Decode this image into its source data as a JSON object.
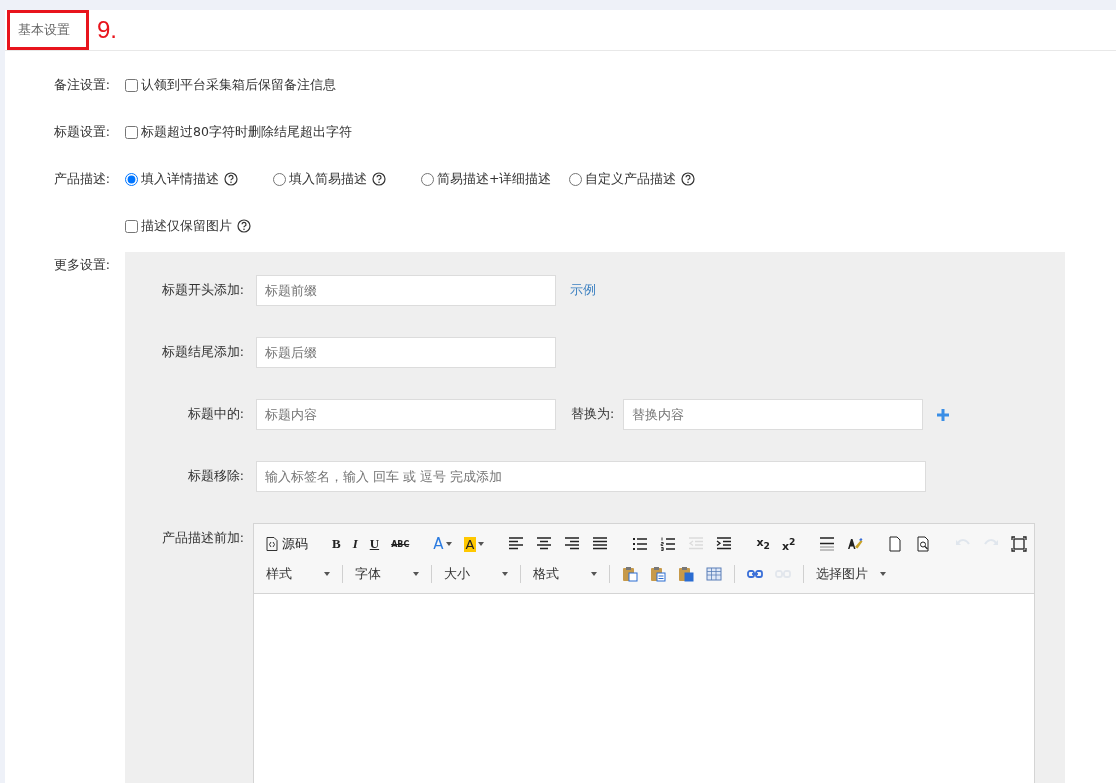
{
  "header": {
    "title": "基本设置",
    "annotation": "9."
  },
  "remark": {
    "label": "备注设置:",
    "checkbox": {
      "label": "认领到平台采集箱后保留备注信息",
      "checked": false
    }
  },
  "title_setting": {
    "label": "标题设置:",
    "checkbox": {
      "label": "标题超过80字符时删除结尾超出字符",
      "checked": false
    }
  },
  "description": {
    "label": "产品描述:",
    "options": [
      {
        "label": "填入详情描述",
        "selected": true,
        "help": true
      },
      {
        "label": "填入简易描述",
        "selected": false,
        "help": true
      },
      {
        "label": "简易描述+详细描述",
        "selected": false,
        "help": false
      },
      {
        "label": "自定义产品描述",
        "selected": false,
        "help": true
      }
    ],
    "images_only": {
      "label": "描述仅保留图片",
      "checked": false,
      "help": true
    }
  },
  "more": {
    "label": "更多设置:",
    "prefix": {
      "label": "标题开头添加:",
      "placeholder": "标题前缀",
      "link": "示例"
    },
    "suffix": {
      "label": "标题结尾添加:",
      "placeholder": "标题后缀"
    },
    "replace": {
      "label": "标题中的:",
      "placeholder": "标题内容",
      "with_label": "替换为:",
      "with_placeholder": "替换内容"
    },
    "remove": {
      "label": "标题移除:",
      "placeholder": "输入标签名，输入 回车 或 逗号 完成添加"
    },
    "editor": {
      "label": "产品描述前加:",
      "toolbar_rows": [
        {
          "items": [
            {
              "kind": "button",
              "label": "源码"
            },
            {
              "kind": "separator"
            },
            {
              "kind": "glyph",
              "label": "B"
            },
            {
              "kind": "glyph",
              "label": "I"
            },
            {
              "kind": "glyph",
              "label": "U"
            },
            {
              "kind": "glyph",
              "label": "ABC"
            },
            {
              "kind": "separator"
            },
            {
              "kind": "glyph",
              "label": "A"
            },
            {
              "kind": "glyph",
              "label": "A"
            },
            {
              "kind": "separator"
            },
            {
              "kind": "icon",
              "disabled": false
            },
            {
              "kind": "icon",
              "disabled": false
            },
            {
              "kind": "icon",
              "disabled": false
            },
            {
              "kind": "icon",
              "disabled": false
            },
            {
              "kind": "separator"
            },
            {
              "kind": "icon",
              "disabled": false
            },
            {
              "kind": "icon",
              "disabled": false
            },
            {
              "kind": "icon",
              "disabled": true
            },
            {
              "kind": "icon",
              "disabled": false
            },
            {
              "kind": "separator"
            },
            {
              "kind": "glyph",
              "label": "x$_{2}$"
            },
            {
              "kind": "glyph",
              "label": "x$^{2}$"
            },
            {
              "kind": "separator"
            },
            {
              "kind": "icon",
              "disabled": false
            },
            {
              "kind": "icon",
              "disabled": false
            },
            {
              "kind": "separator"
            },
            {
              "kind": "icon",
              "disabled": false
            },
            {
              "kind": "icon",
              "disabled": false
            },
            {
              "kind": "separator"
            },
            {
              "kind": "icon",
              "disabled": true
            },
            {
              "kind": "icon",
              "disabled": true
            },
            {
              "kind": "icon",
              "disabled": false
            }
          ]
        },
        {
          "items": [
            {
              "kind": "dropdown",
              "label": "样式"
            },
            {
              "kind": "separator"
            },
            {
              "kind": "dropdown",
              "label": "字体"
            },
            {
              "kind": "separator"
            },
            {
              "kind": "dropdown",
              "label": "大小"
            },
            {
              "kind": "separator"
            },
            {
              "kind": "dropdown",
              "label": "格式"
            },
            {
              "kind": "separator"
            },
            {
              "kind": "icon",
              "disabled": false
            },
            {
              "kind": "icon",
              "disabled": false
            },
            {
              "kind": "icon",
              "disabled": false
            },
            {
              "kind": "icon",
              "disabled": false
            },
            {
              "kind": "separator"
            },
            {
              "kind": "icon",
              "disabled": false
            },
            {
              "kind": "icon",
              "disabled": true
            },
            {
              "kind": "separator"
            },
            {
              "kind": "dropdown",
              "label": "选择图片"
            }
          ]
        }
      ]
    }
  }
}
